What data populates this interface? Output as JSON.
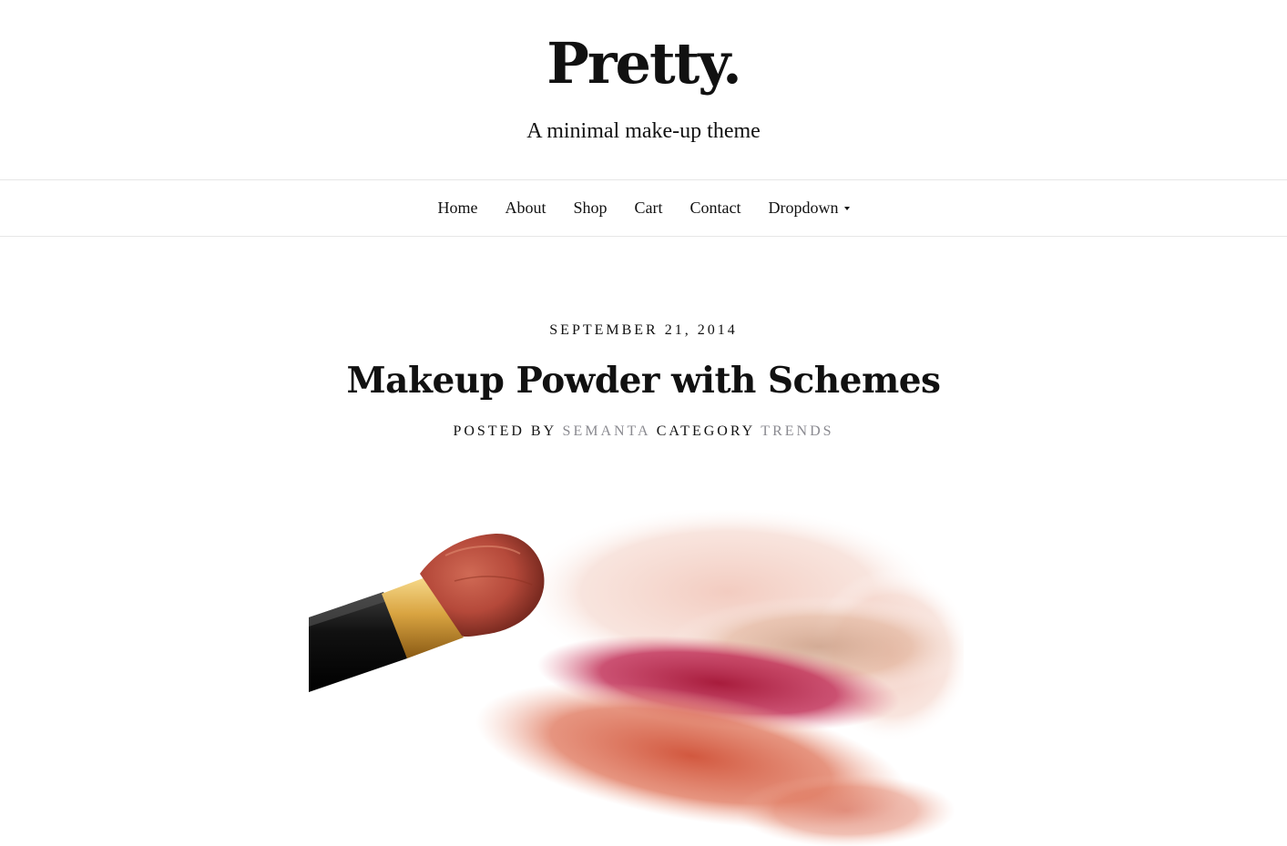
{
  "site": {
    "title": "Pretty.",
    "tagline": "A minimal make-up theme"
  },
  "nav": {
    "items": [
      {
        "label": "Home"
      },
      {
        "label": "About"
      },
      {
        "label": "Shop"
      },
      {
        "label": "Cart"
      },
      {
        "label": "Contact"
      },
      {
        "label": "Dropdown",
        "has_dropdown": true
      }
    ]
  },
  "post": {
    "date": "SEPTEMBER 21, 2014",
    "title": "Makeup Powder with Schemes",
    "meta": {
      "posted_by_label": "POSTED BY",
      "author": "SEMANTA",
      "category_label": "CATEGORY",
      "category": "TRENDS"
    },
    "image": {
      "subject": "makeup brush with crushed powder",
      "colors": {
        "handle": "#111111",
        "ferrule": "#d9a441",
        "bristles": "#b5493a",
        "powder_light": "#f2c9bd",
        "powder_crimson": "#b0233f",
        "powder_coral": "#d9684f",
        "powder_beige": "#e0b49a"
      }
    }
  },
  "colors": {
    "text": "#111111",
    "meta_link": "#8a8a90",
    "border": "#e6e6e6",
    "background": "#ffffff"
  }
}
